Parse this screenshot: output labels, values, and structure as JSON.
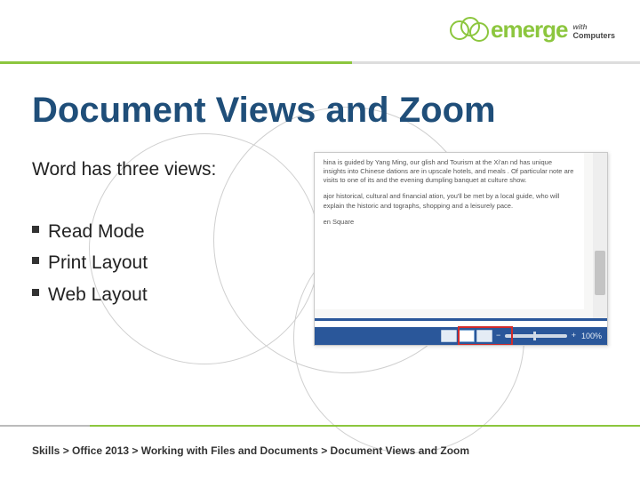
{
  "brand": {
    "word": "emerge",
    "with": "with",
    "sub": "Computers"
  },
  "title": "Document Views and Zoom",
  "intro": "Word has three views:",
  "bullets": [
    {
      "label": "Read Mode"
    },
    {
      "label": "Print Layout"
    },
    {
      "label": "Web Layout"
    }
  ],
  "screenshot": {
    "para1": "hina is guided by Yang Ming, our glish and Tourism at the Xi'an nd has unique insights into Chinese dations are in upscale hotels, and meals . Of particular note are visits to one of its and the evening dumpling banquet at culture show.",
    "para2": "ajor historical, cultural and financial ation, you'll be met by a local guide, who will explain the historic and tographs, shopping and a leisurely pace.",
    "para3": "en Square",
    "zoom_pct": "100%"
  },
  "breadcrumb": "Skills > Office 2013 > Working with Files and Documents > Document Views and Zoom"
}
